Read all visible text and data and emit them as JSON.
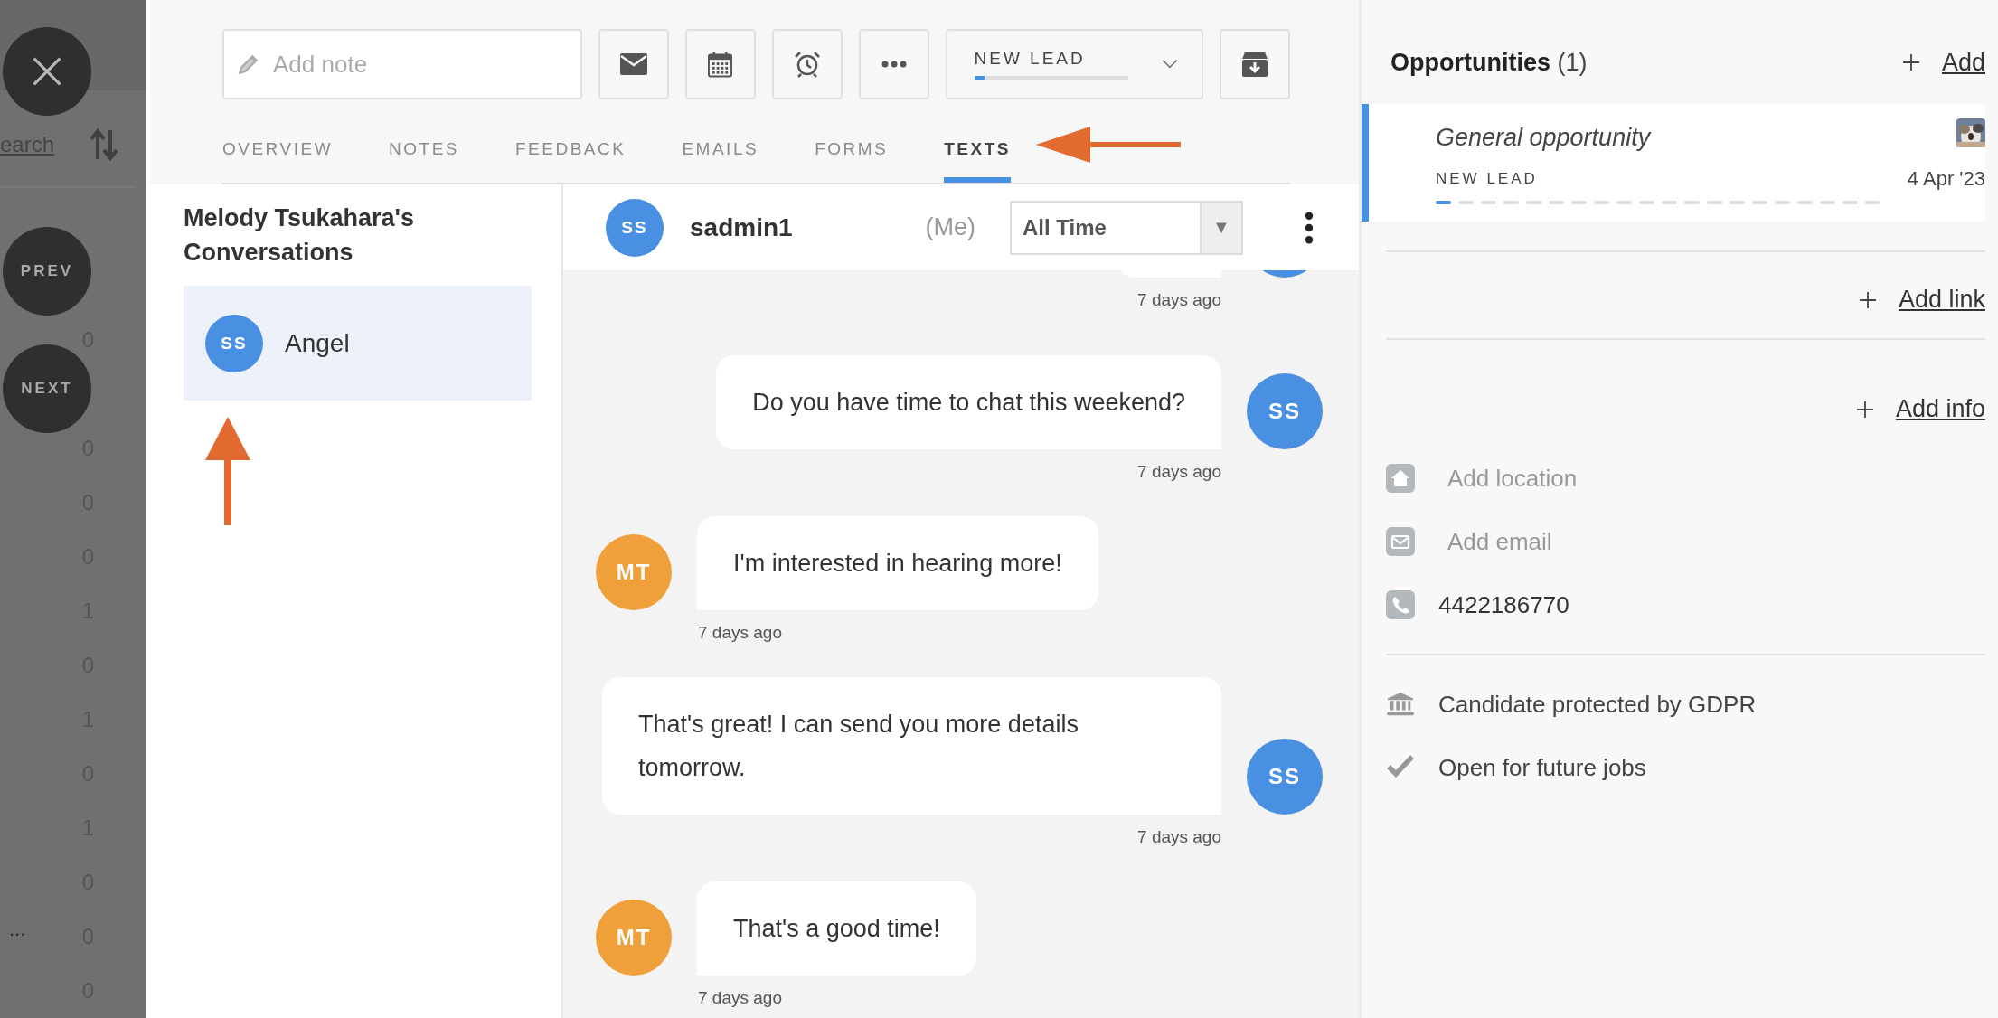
{
  "overlay": {
    "buttons": [
      {
        "kind": "close"
      },
      {
        "kind": "text",
        "label": "PREV"
      },
      {
        "kind": "text",
        "label": "NEXT"
      }
    ],
    "search_link": "earch",
    "counts": [
      "0",
      "0",
      "0",
      "0",
      "1",
      "0",
      "1",
      "0",
      "1",
      "0",
      "0",
      "0"
    ],
    "more": "..."
  },
  "toolbar": {
    "note": {
      "placeholder": "Add note"
    },
    "actions": [
      {
        "kind": "email"
      },
      {
        "kind": "calendar"
      },
      {
        "kind": "alarm"
      },
      {
        "kind": "more"
      }
    ],
    "status": {
      "label": "NEW LEAD",
      "level": 0.07
    },
    "end_actions": [
      {
        "kind": "archive"
      }
    ]
  },
  "tabs": [
    {
      "label": "OVERVIEW",
      "selected": false
    },
    {
      "label": "NOTES",
      "selected": false
    },
    {
      "label": "FEEDBACK",
      "selected": false
    },
    {
      "label": "EMAILS",
      "selected": false
    },
    {
      "label": "FORMS",
      "selected": false
    },
    {
      "label": "TEXTS",
      "selected": true
    }
  ],
  "annotations": {
    "tab_arrow": {
      "kind": "left"
    },
    "list_arrow": {
      "kind": "up"
    }
  },
  "conversations": {
    "title": "Melody Tsukahara's Conversations",
    "items": [
      {
        "initials": "SS",
        "name": "Angel",
        "selected": true
      }
    ]
  },
  "chat": {
    "header": {
      "initials": "SS",
      "name": "sadmin1",
      "note": "(Me)",
      "filter": "All Time",
      "filter_arrow": "▼"
    },
    "messages": [
      {
        "kind": "outgoing",
        "color": "#4a90e2",
        "time": "7 days ago"
      },
      {
        "kind": "outgoing",
        "initials": "SS",
        "color": "#4a90e2",
        "text": "Do you have time to chat this weekend?",
        "time": "7 days ago"
      },
      {
        "kind": "incoming",
        "initials": "MT",
        "color": "#f0a03a",
        "text": "I'm interested in hearing more!",
        "time": "7 days ago"
      },
      {
        "kind": "outgoing",
        "initials": "SS",
        "color": "#4a90e2",
        "text": "That's great! I can send you more details tomorrow.",
        "time": "7 days ago"
      },
      {
        "kind": "incoming",
        "initials": "MT",
        "color": "#f0a03a",
        "text": "That's a good time!",
        "time": "7 days ago"
      }
    ]
  },
  "side_panel": {
    "opportunities": {
      "title": "Opportunities",
      "count": "(1)",
      "add": "Add",
      "items": [
        {
          "name": "General opportunity",
          "stage": "NEW LEAD",
          "level": 0.05,
          "date": "4 Apr '23"
        }
      ]
    },
    "links": [
      {
        "label": "Add link"
      },
      {
        "label": "Add info"
      }
    ],
    "contacts": [
      {
        "kind": "location",
        "text": "Add location",
        "empty": true
      },
      {
        "kind": "email",
        "text": "Add email",
        "empty": true
      },
      {
        "kind": "phone",
        "text": "4422186770",
        "empty": false
      }
    ],
    "flags": [
      {
        "kind": "gdpr",
        "text": "Candidate protected by GDPR"
      },
      {
        "kind": "check",
        "text": "Open for future jobs"
      }
    ]
  }
}
